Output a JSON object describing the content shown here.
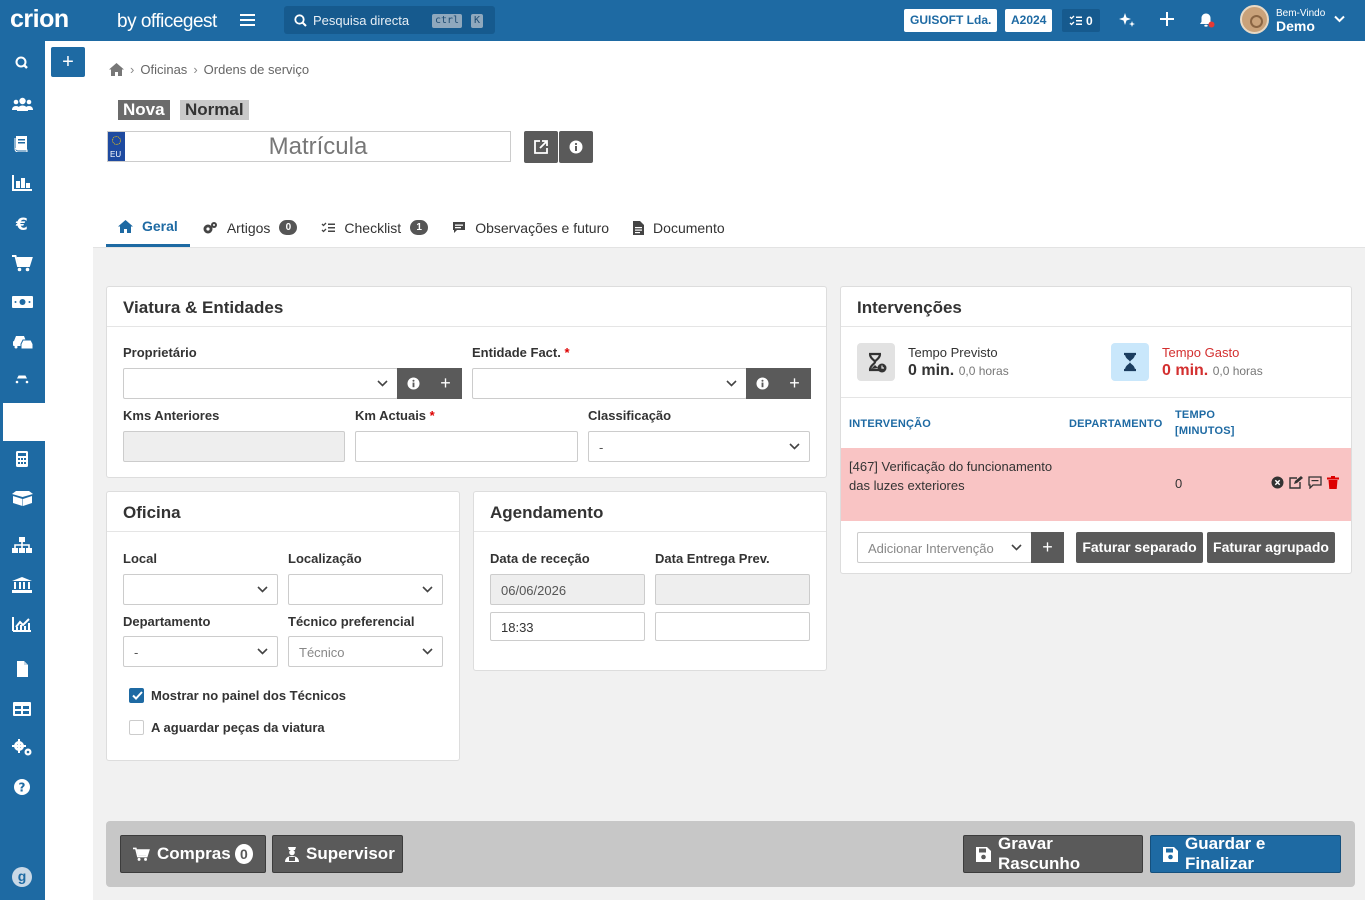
{
  "topbar": {
    "logo": "crion",
    "logo_by": "by officegest",
    "search_placeholder": "Pesquisa directa",
    "kbd_ctrl": "ctrl",
    "kbd_k": "K",
    "company": "GUISOFT Lda.",
    "year": "A2024",
    "tasks_count": "0",
    "welcome": "Bem-Vindo",
    "user": "Demo"
  },
  "sidebar": {
    "items": [
      "search",
      "users",
      "book",
      "dashboard",
      "euro",
      "cart",
      "money",
      "vehicles",
      "car",
      "plus",
      "calculator",
      "box",
      "org",
      "bank",
      "chart",
      "file",
      "table",
      "settings",
      "help"
    ],
    "bottom_icon": "g"
  },
  "breadcrumb": {
    "items": [
      "Oficinas",
      "Ordens de serviço"
    ]
  },
  "status": {
    "state": "Nova",
    "priority": "Normal"
  },
  "plate": {
    "placeholder": "Matrícula",
    "eu": "EU"
  },
  "tabs": [
    {
      "label": "Geral",
      "icon": "home-icon",
      "active": true
    },
    {
      "label": "Artigos",
      "icon": "cog-icon",
      "count": "0"
    },
    {
      "label": "Checklist",
      "icon": "checklist-icon",
      "count": "1"
    },
    {
      "label": "Observações e futuro",
      "icon": "comment-icon"
    },
    {
      "label": "Documento",
      "icon": "doc-icon"
    }
  ],
  "viatura": {
    "title": "Viatura & Entidades",
    "proprietario": "Proprietário",
    "entidade": "Entidade Fact.",
    "kms_anteriores": "Kms Anteriores",
    "km_actuais": "Km Actuais",
    "classificacao": "Classificação",
    "classificacao_value": "-",
    "required_mark": "*"
  },
  "oficina": {
    "title": "Oficina",
    "local": "Local",
    "localizacao": "Localização",
    "departamento": "Departamento",
    "departamento_value": "-",
    "tecnico": "Técnico preferencial",
    "tecnico_placeholder": "Técnico",
    "chk1": "Mostrar no painel dos Técnicos",
    "chk1_checked": true,
    "chk2": "A aguardar peças da viatura",
    "chk2_checked": false
  },
  "agendamento": {
    "title": "Agendamento",
    "data_rececao": "Data de receção",
    "data_entrega": "Data Entrega Prev.",
    "date_value": "06/06/2026",
    "time_value": "18:33"
  },
  "intervencoes": {
    "title": "Intervenções",
    "previsto_label": "Tempo Previsto",
    "previsto_value": "0 min.",
    "previsto_hours": "0,0 horas",
    "gasto_label": "Tempo Gasto",
    "gasto_value": "0 min.",
    "gasto_hours": "0,0 horas",
    "col_intervencao": "INTERVENÇÃO",
    "col_departamento": "DEPARTAMENTO",
    "col_tempo": "TEMPO",
    "col_tempo2": "[MINUTOS]",
    "rows": [
      {
        "text": "[467] Verificação do funcionamento das luzes exteriores",
        "minutes": "0"
      }
    ],
    "add_placeholder": "Adicionar Intervenção",
    "faturar_separado": "Faturar separado",
    "faturar_agrupado": "Faturar agrupado"
  },
  "footer": {
    "compras": "Compras",
    "compras_count": "0",
    "supervisor": "Supervisor",
    "gravar": "Gravar Rascunho",
    "guardar": "Guardar e Finalizar"
  },
  "colors": {
    "primary": "#1e6aa3",
    "danger_row": "#f9c4c4",
    "danger_text": "#d32f2f"
  }
}
